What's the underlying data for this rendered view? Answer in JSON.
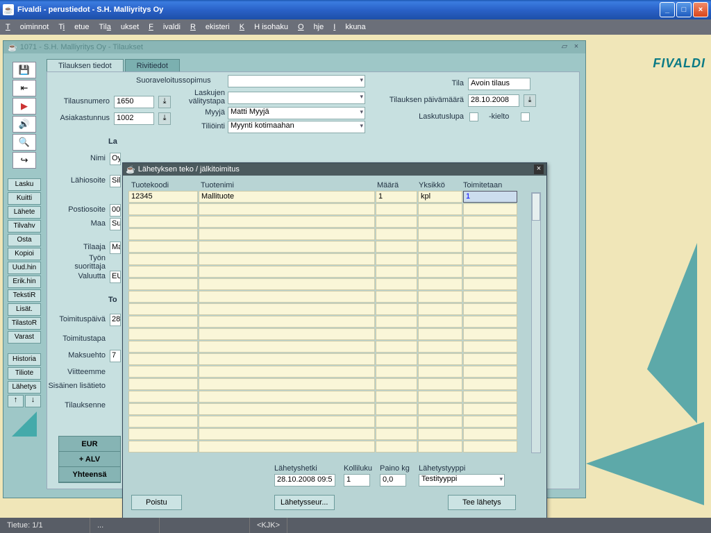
{
  "window": {
    "title": "Fivaldi - perustiedot - S.H. Malliyritys Oy",
    "brand": "FIVALDI"
  },
  "menu": [
    "Toiminnot",
    "Tietue",
    "Tilaukset",
    "Fivaldi",
    "Rekisteri",
    "KH isohaku",
    "Ohje",
    "Ikkuna"
  ],
  "mdi": {
    "title": "1071 - S.H. Malliyritys Oy - Tilaukset"
  },
  "tabs": {
    "t1": "Tilauksen tiedot",
    "t2": "Rivitiedot"
  },
  "side_buttons": [
    "Lasku",
    "Kuitti",
    "Lähete",
    "Tilvahv",
    "Osta",
    "Kopioi",
    "Uud.hin",
    "Erik.hin",
    "TekstiR",
    "Lisät.",
    "TilastoR",
    "Varast",
    "Historia",
    "Tiliote",
    "Lähetys"
  ],
  "form": {
    "tilausnumero_l": "Tilausnumero",
    "tilausnumero": "1650",
    "asiakastunnus_l": "Asiakastunnus",
    "asiakastunnus": "1002",
    "suorav": "Suoraveloitussopimus",
    "laskujen": "Laskujen välitystapa",
    "myyja_l": "Myyjä",
    "myyja": "Matti Myyjä",
    "tiliointi_l": "Tiliöinti",
    "tiliointi": "Myynti kotimaahan",
    "tila_l": "Tila",
    "tila": "Avoin tilaus",
    "tilpvm_l": "Tilauksen päivämäärä",
    "tilpvm": "28.10.2008",
    "laskutuslupa": "Laskutuslupa",
    "kielto": "-kielto",
    "nimi_l": "Nimi",
    "nimi": "Oy",
    "lahi_l": "Lähiosoite",
    "lahi": "Sil",
    "posti_l": "Postiosoite",
    "posti": "00",
    "maa_l": "Maa",
    "maa": "Su",
    "tilaaja_l": "Tilaaja",
    "tilaaja": "Ma",
    "tyon_l": "Työn suorittaja",
    "valuutta_l": "Valuutta",
    "valuutta": "EU",
    "sec2": "La",
    "sec3": "To",
    "toimpvm_l": "Toimituspäivä",
    "toimpvm": "28",
    "toimtapa_l": "Toimitustapa",
    "maksu_l": "Maksuehto",
    "maksu": "7",
    "viite_l": "Viitteemme",
    "sisa_l": "Sisäinen lisätieto",
    "tilsenne_l": "Tilauksenne"
  },
  "summary": {
    "r1": "EUR",
    "r2": "+ ALV",
    "r3": "Yhteensä"
  },
  "dialog": {
    "title": "Lähetyksen teko / jälkitoimitus",
    "headers": {
      "c1": "Tuotekoodi",
      "c2": "Tuotenimi",
      "c3": "Määrä",
      "c4": "Yksikkö",
      "c5": "Toimitetaan"
    },
    "row": {
      "code": "12345",
      "name": "Mallituote",
      "qty": "1",
      "unit": "kpl",
      "deliver": "1"
    },
    "lähetyshetki_l": "Lähetyshetki",
    "lähetyshetki": "28.10.2008 09:5",
    "kolli_l": "Kolliluku",
    "kolli": "1",
    "paino_l": "Paino kg",
    "paino": "0,0",
    "tyyppi_l": "Lähetystyyppi",
    "tyyppi": "Testityyppi",
    "poistu": "Poistu",
    "seur": "Lähetysseur...",
    "tee": "Tee lähetys"
  },
  "status": {
    "tietue": "Tietue: 1/1",
    "dots": "...",
    "user": "<KJK>"
  }
}
